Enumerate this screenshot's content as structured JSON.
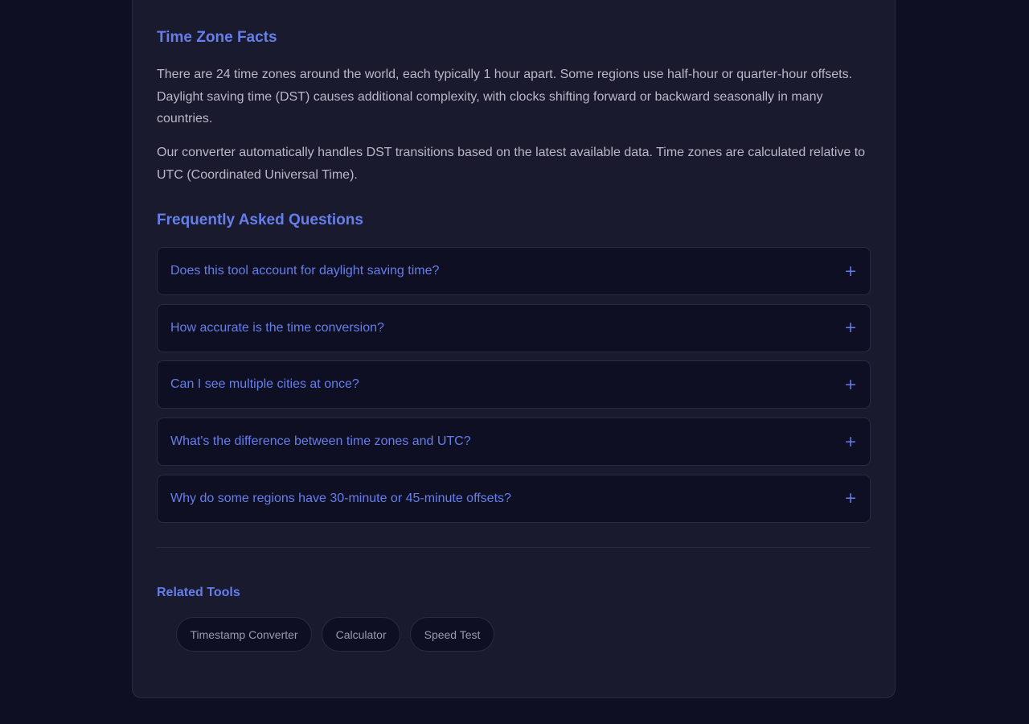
{
  "facts": {
    "heading": "Time Zone Facts",
    "paragraph1": "There are 24 time zones around the world, each typically 1 hour apart. Some regions use half-hour or quarter-hour offsets. Daylight saving time (DST) causes additional complexity, with clocks shifting forward or backward seasonally in many countries.",
    "paragraph2": "Our converter automatically handles DST transitions based on the latest available data. Time zones are calculated relative to UTC (Coordinated Universal Time)."
  },
  "faq": {
    "heading": "Frequently Asked Questions",
    "items": [
      {
        "question": "Does this tool account for daylight saving time?",
        "icon": "+"
      },
      {
        "question": "How accurate is the time conversion?",
        "icon": "+"
      },
      {
        "question": "Can I see multiple cities at once?",
        "icon": "+"
      },
      {
        "question": "What's the difference between time zones and UTC?",
        "icon": "+"
      },
      {
        "question": "Why do some regions have 30-minute or 45-minute offsets?",
        "icon": "+"
      }
    ]
  },
  "related": {
    "heading": "Related Tools",
    "tools": [
      "Timestamp Converter",
      "Calculator",
      "Speed Test"
    ]
  },
  "colors": {
    "page_background": "#0f0f23",
    "card_background": "#1a1a2e",
    "accent": "#667eea",
    "body_text": "#b8b8c8"
  }
}
